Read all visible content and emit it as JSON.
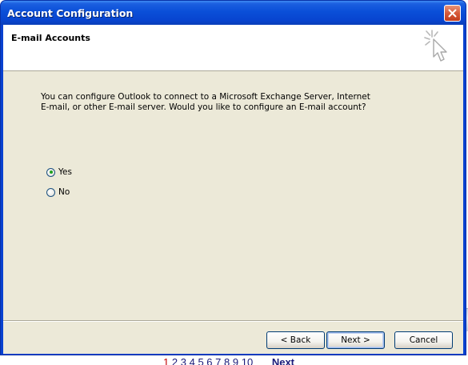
{
  "window": {
    "title": "Account Configuration"
  },
  "header": {
    "title": "E-mail Accounts"
  },
  "body": {
    "line1": "You can configure Outlook to connect to a Microsoft Exchange Server, Internet",
    "line2": "E-mail, or other E-mail server.  Would you like to configure an E-mail account?"
  },
  "options": [
    {
      "label": "Yes",
      "selected": true
    },
    {
      "label": "No",
      "selected": false
    }
  ],
  "buttons": {
    "back": "< Back",
    "next": "Next >",
    "cancel": "Cancel"
  },
  "background_page": {
    "pager": [
      "1",
      "2",
      "3",
      "4",
      "5",
      "6",
      "7",
      "8",
      "9",
      "10"
    ],
    "next_link": "Next"
  },
  "colors": {
    "titlebar": "#0a4fd8",
    "dialog_bg": "#ece9d8",
    "close": "#d65a3a"
  }
}
